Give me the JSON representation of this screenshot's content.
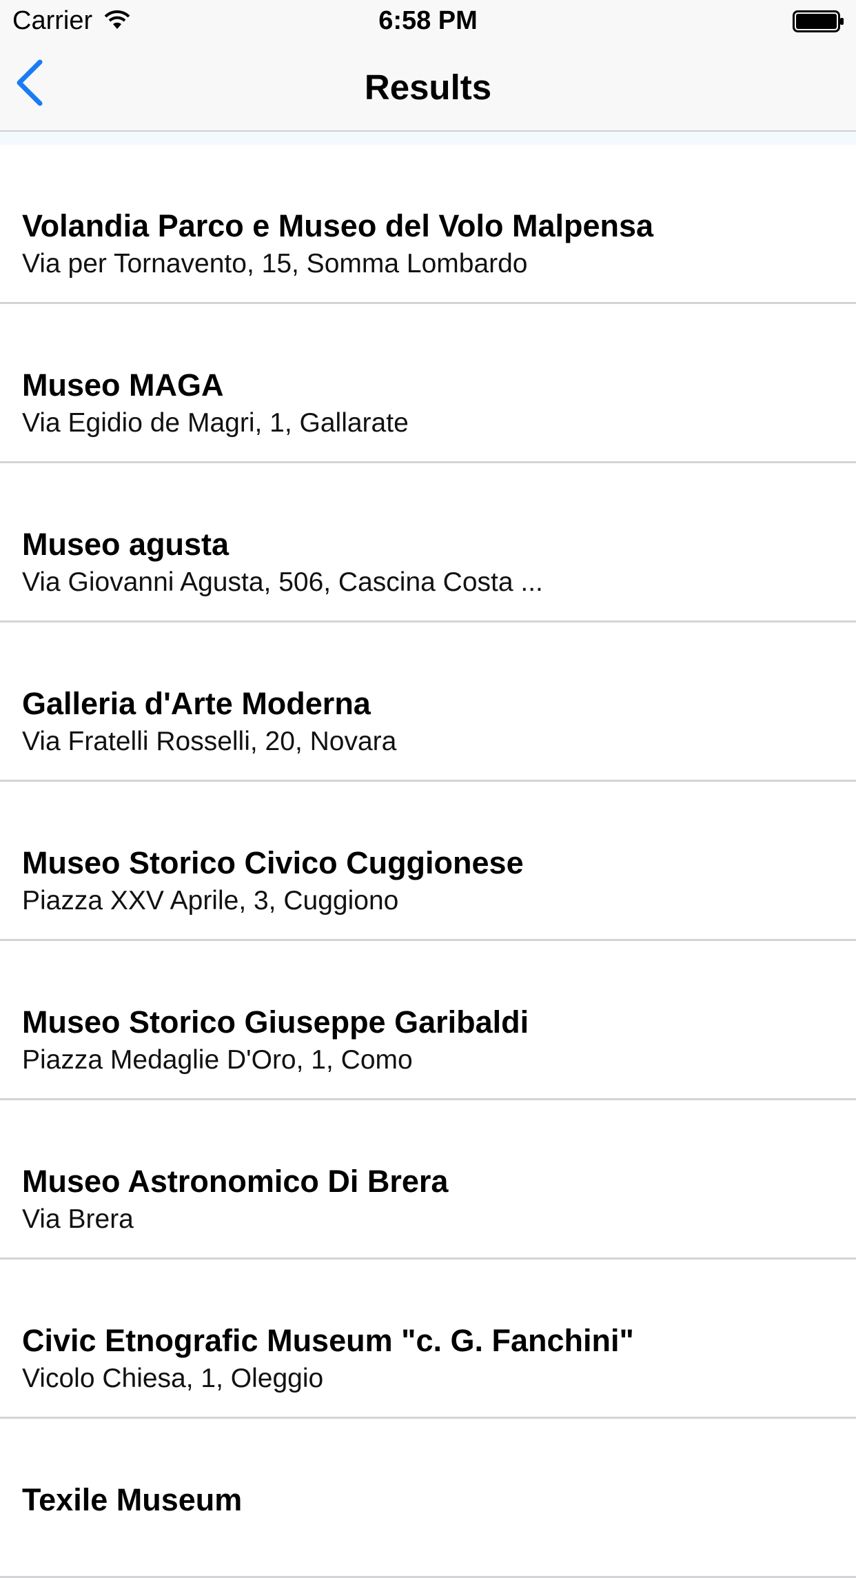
{
  "status_bar": {
    "carrier": "Carrier",
    "time": "6:58 PM",
    "wifi_icon": "wifi-icon",
    "battery_icon": "battery-full-icon"
  },
  "nav": {
    "back_icon": "chevron-left-icon",
    "title": "Results",
    "accent_color": "#1a7cf5"
  },
  "results": [
    {
      "name": "Volandia Parco e Museo del Volo Malpensa",
      "address": "Via per Tornavento, 15, Somma Lombardo"
    },
    {
      "name": "Museo MAGA",
      "address": "Via Egidio de Magri, 1, Gallarate"
    },
    {
      "name": "Museo agusta",
      "address": "Via Giovanni Agusta, 506, Cascina Costa ..."
    },
    {
      "name": "Galleria d'Arte Moderna",
      "address": "Via Fratelli Rosselli, 20, Novara"
    },
    {
      "name": "Museo Storico Civico Cuggionese",
      "address": "Piazza XXV Aprile, 3, Cuggiono"
    },
    {
      "name": "Museo Storico Giuseppe Garibaldi",
      "address": "Piazza Medaglie D'Oro, 1, Como"
    },
    {
      "name": "Museo Astronomico Di Brera",
      "address": "Via Brera"
    },
    {
      "name": "Civic Etnografic Museum \"c. G. Fanchini\"",
      "address": "Vicolo Chiesa, 1, Oleggio"
    },
    {
      "name": "Texile Museum",
      "address": ""
    }
  ]
}
